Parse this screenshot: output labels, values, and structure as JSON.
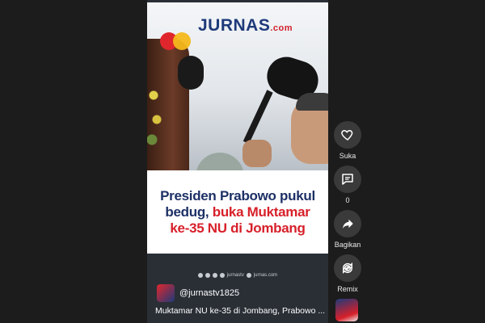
{
  "brand": {
    "name": "JURNAS",
    "suffix": ".com"
  },
  "headline": {
    "line1": "Presiden Prabowo pukul",
    "line2_part1": "bedug, ",
    "line2_part2": "buka Muktamar",
    "line3": "ke-35 NU di Jombang"
  },
  "video_footer": {
    "social_handle": "jurnastv",
    "site": "jurnas.com"
  },
  "channel": {
    "handle": "@jurnastv1825"
  },
  "caption": "Muktamar NU ke-35 di Jombang, Prabowo ...",
  "actions": {
    "like_label": "Suka",
    "comment_count": "0",
    "share_label": "Bagikan",
    "remix_label": "Remix"
  },
  "colors": {
    "navy": "#1d3066",
    "red": "#d7202a",
    "background": "#1c1c1c"
  }
}
